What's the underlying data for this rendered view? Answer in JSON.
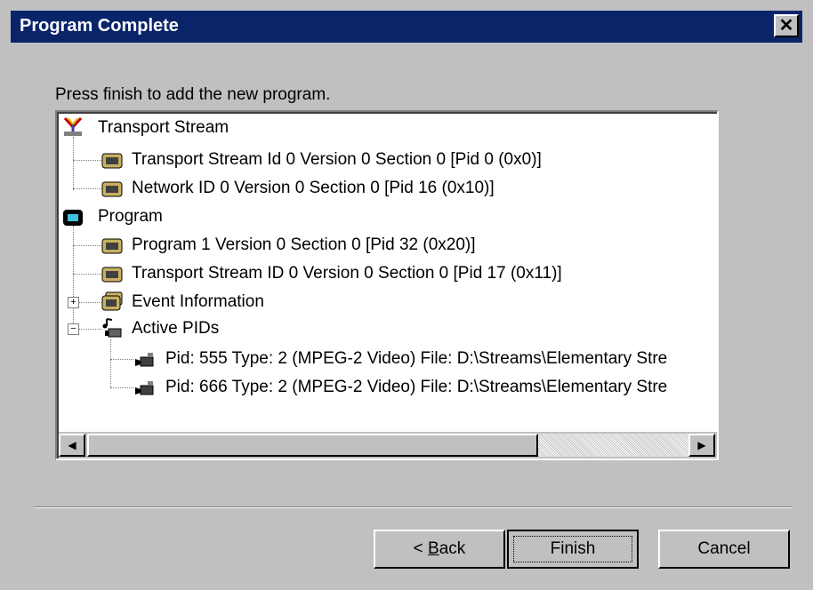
{
  "window": {
    "title": "Program Complete"
  },
  "instruction": "Press finish to add the new program.",
  "tree": {
    "transport_stream": {
      "label": "Transport Stream",
      "children": [
        "Transport Stream Id 0 Version 0 Section 0 [Pid 0 (0x0)]",
        "Network ID 0 Version 0 Section 0 [Pid 16 (0x10)]"
      ]
    },
    "program": {
      "label": "Program",
      "children": [
        "Program 1 Version 0 Section 0 [Pid 32 (0x20)]",
        "Transport Stream ID 0 Version 0 Section 0 [Pid 17 (0x11)]"
      ],
      "event_information": "Event Information",
      "active_pids": {
        "label": "Active PIDs",
        "children": [
          "Pid: 555 Type: 2 (MPEG-2 Video) File: D:\\Streams\\Elementary Stre",
          "Pid: 666 Type: 2 (MPEG-2 Video) File: D:\\Streams\\Elementary Stre"
        ]
      }
    }
  },
  "buttons": {
    "back": "Back",
    "back_prefix": "< ",
    "back_mnemonic": "B",
    "back_rest": "ack",
    "finish": "Finish",
    "cancel": "Cancel"
  },
  "scrollbar": {
    "position_fraction": 0.0,
    "visible_fraction": 0.75
  },
  "close_glyph": "✕"
}
